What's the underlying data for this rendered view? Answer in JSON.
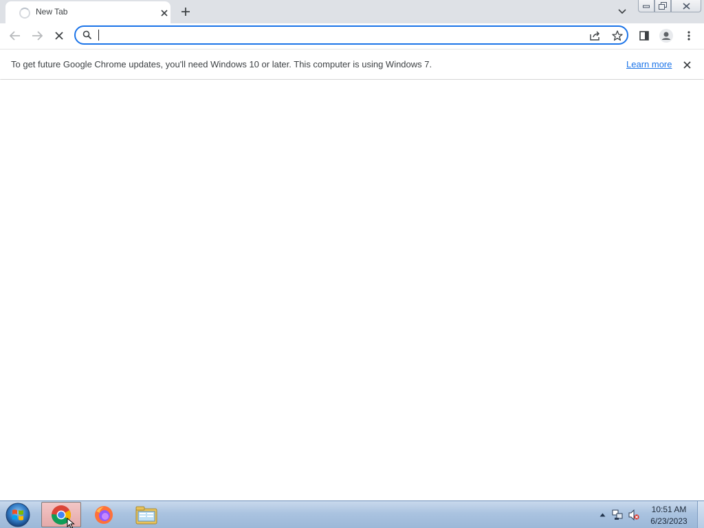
{
  "window": {
    "tab_title": "New Tab"
  },
  "omnibox": {
    "value": "",
    "placeholder": ""
  },
  "infobar": {
    "message": "To get future Google Chrome updates, you'll need Windows 10 or later. This computer is using Windows 7.",
    "learn_more": "Learn more"
  },
  "taskbar": {
    "items": [
      {
        "name": "chrome",
        "icon": "chrome-icon",
        "active": true
      },
      {
        "name": "firefox",
        "icon": "firefox-icon",
        "active": false
      },
      {
        "name": "explorer",
        "icon": "folder-icon",
        "active": false
      }
    ],
    "clock_time": "10:51 AM",
    "clock_date": "6/23/2023"
  },
  "colors": {
    "accent": "#1a73e8",
    "tabstrip": "#dee1e6",
    "taskbar": "#aac3e0"
  }
}
